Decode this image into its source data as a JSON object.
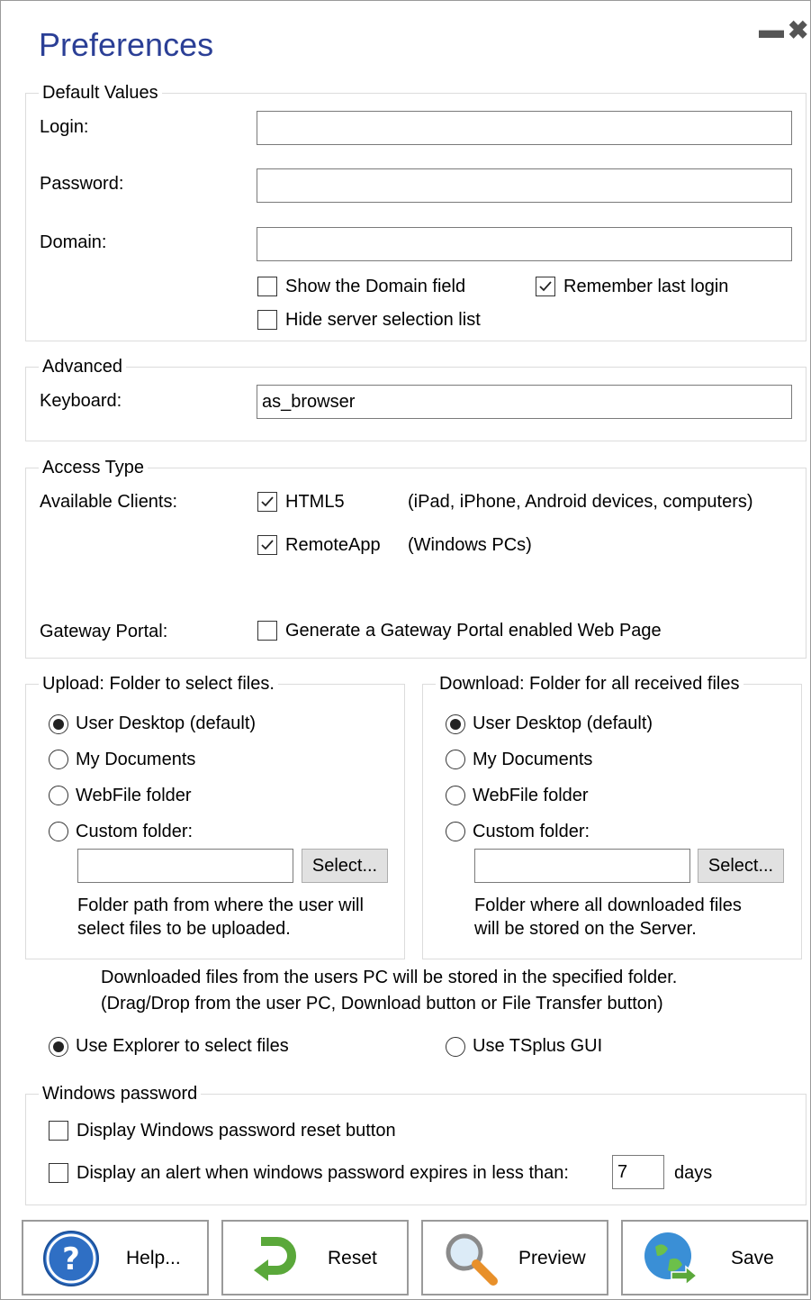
{
  "window": {
    "title": "Preferences",
    "minimize_glyph": "▬",
    "close_glyph": "✖"
  },
  "default_values": {
    "legend": "Default Values",
    "login_label": "Login:",
    "login_value": "",
    "password_label": "Password:",
    "password_value": "",
    "domain_label": "Domain:",
    "domain_value": "",
    "show_domain_label": "Show the Domain field",
    "show_domain_checked": false,
    "remember_login_label": "Remember last login",
    "remember_login_checked": true,
    "hide_server_list_label": "Hide server selection list",
    "hide_server_list_checked": false
  },
  "advanced": {
    "legend": "Advanced",
    "keyboard_label": "Keyboard:",
    "keyboard_value": "as_browser"
  },
  "access_type": {
    "legend": "Access Type",
    "available_clients_label": "Available Clients:",
    "html5_label": "HTML5",
    "html5_checked": true,
    "html5_desc": "(iPad, iPhone, Android devices, computers)",
    "remoteapp_label": "RemoteApp",
    "remoteapp_checked": true,
    "remoteapp_desc": "(Windows PCs)",
    "gateway_label": "Gateway Portal:",
    "gateway_option_label": "Generate a Gateway Portal enabled Web Page",
    "gateway_checked": false
  },
  "upload": {
    "legend": "Upload: Folder to select files.",
    "options": [
      "User Desktop (default)",
      "My Documents",
      "WebFile folder",
      "Custom folder:"
    ],
    "selected_index": 0,
    "folder_value": "",
    "select_button": "Select...",
    "note_line1": "Folder path from where the user will",
    "note_line2": "select files to be uploaded."
  },
  "download": {
    "legend": "Download: Folder for all received files",
    "options": [
      "User Desktop (default)",
      "My Documents",
      "WebFile folder",
      "Custom folder:"
    ],
    "selected_index": 0,
    "folder_value": "",
    "select_button": "Select...",
    "note_line1": "Folder where all downloaded files",
    "note_line2": "will be stored on the Server."
  },
  "transfer_note": {
    "line1": "Downloaded files from the users PC will be stored in the specified folder.",
    "line2": "(Drag/Drop from the user PC, Download button or File Transfer button)"
  },
  "file_selector": {
    "explorer_label": "Use Explorer to select files",
    "explorer_selected": true,
    "tsplus_label": "Use TSplus GUI",
    "tsplus_selected": false
  },
  "windows_password": {
    "legend": "Windows password",
    "reset_button_label": "Display Windows password reset button",
    "reset_button_checked": false,
    "alert_label": "Display an alert when windows password expires in less than:",
    "alert_checked": false,
    "alert_days_value": "7",
    "days_label": "days"
  },
  "buttons": {
    "help": "Help...",
    "reset": "Reset",
    "preview": "Preview",
    "save": "Save"
  },
  "colors": {
    "title": "#2b3f96",
    "group_border": "#dcdcdc",
    "help_icon": "#2f6fc4",
    "reset_icon": "#5aa83a",
    "save_icon": "#3a8fd6"
  }
}
